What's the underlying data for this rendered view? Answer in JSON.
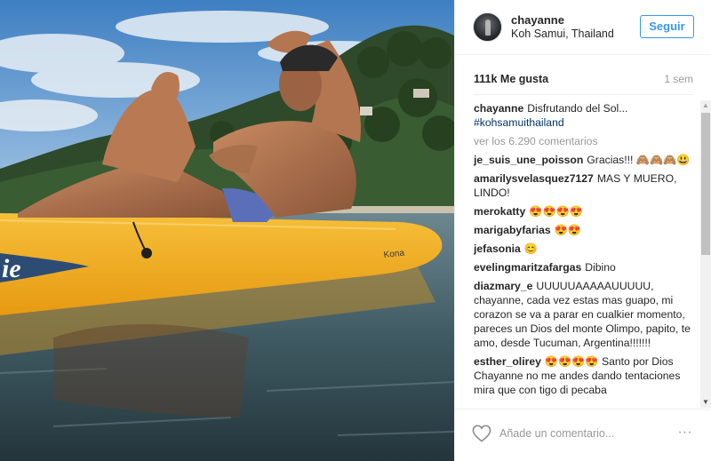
{
  "post": {
    "username": "chayanne",
    "location": "Koh Samui, Thailand",
    "follow_label": "Seguir",
    "likes": "111k Me gusta",
    "time": "1 sem",
    "kayak_brand": "Kona",
    "kayak_logo": "ie"
  },
  "caption": {
    "user": "chayanne",
    "text": "Disfrutando del Sol...",
    "hashtag": "#kohsamuithailand"
  },
  "view_all": "ver los 6.290 comentarios",
  "comments": [
    {
      "user": "je_suis_une_poisson",
      "text": "Gracias!!! 🙈🙈🙈😃"
    },
    {
      "user": "amarilysvelasquez7127",
      "text": "MAS Y MUERO, LINDO!"
    },
    {
      "user": "merokatty",
      "text": "😍😍😍😍"
    },
    {
      "user": "marigabyfarias",
      "text": "😍😍"
    },
    {
      "user": "jefasonia",
      "text": "😊"
    },
    {
      "user": "evelingmaritzafargas",
      "text": "Dibino"
    },
    {
      "user": "diazmary_e",
      "text": "UUUUUAAAAAUUUUU, chayanne, cada vez estas mas guapo, mi corazon se va a parar en cualkier momento, pareces un Dios del monte Olimpo, papito, te amo, desde Tucuman, Argentina!!!!!!!"
    },
    {
      "user": "esther_olirey",
      "text": "😍😍😍😍 Santo por Dios Chayanne no me andes dando tentaciones mira que con tigo di pecaba"
    }
  ],
  "footer": {
    "comment_placeholder": "Añade un comentario...",
    "more_label": "∙∙∙"
  },
  "icons": {
    "heart": "heart-icon",
    "more": "more-options-icon",
    "scroll_up": "scroll-up-arrow-icon",
    "scroll_down": "scroll-down-arrow-icon"
  },
  "colors": {
    "accent": "#3897f0",
    "hashtag": "#003569",
    "kayak": "#f2b01e",
    "water": "#3f5a63",
    "sky": "#4f8fce"
  }
}
